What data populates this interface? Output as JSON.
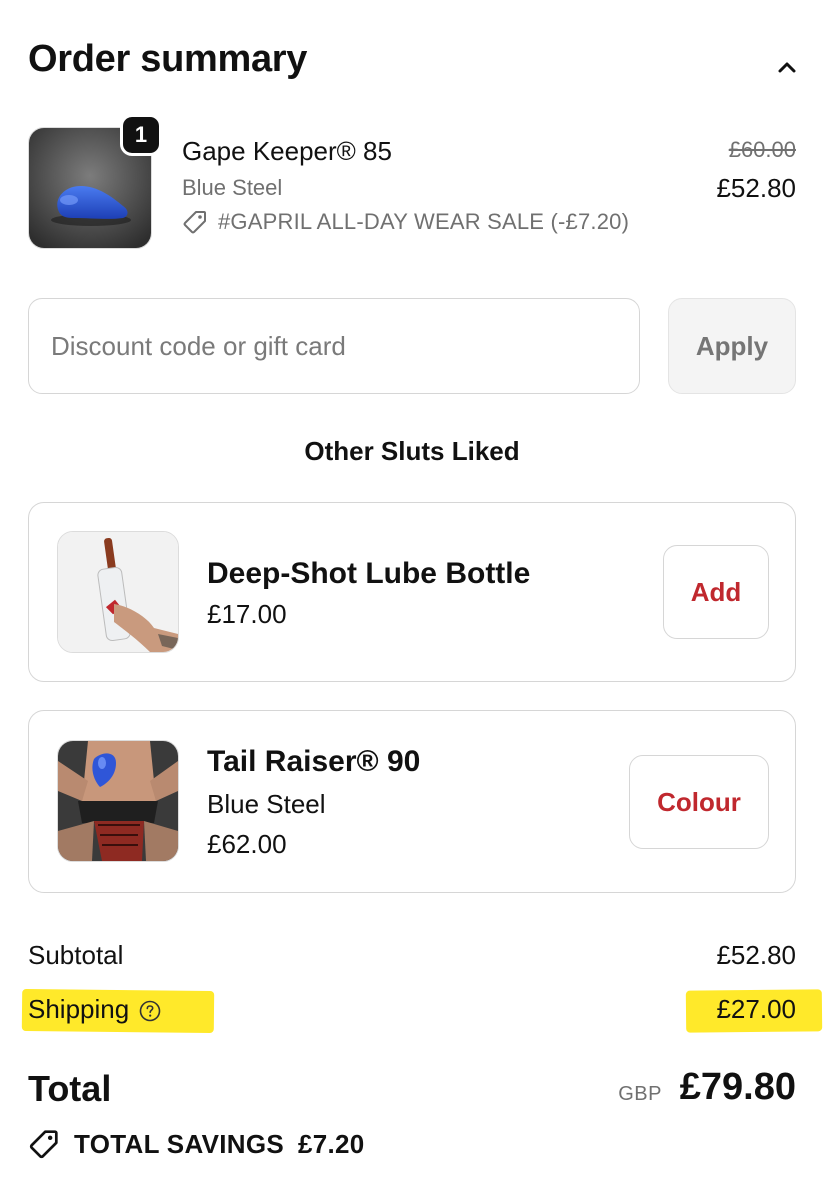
{
  "header": {
    "title": "Order summary",
    "toggle_icon": "chevron-up-icon"
  },
  "order_item": {
    "image": "blue butt plug product photo",
    "quantity": "1",
    "name": "Gape Keeper® 85",
    "variant": "Blue Steel",
    "discount_icon": "tag-icon",
    "discount_label": "#GAPRIL ALL-DAY WEAR SALE (-£7.20)",
    "original_price": "£60.00",
    "price": "£52.80"
  },
  "discount": {
    "placeholder": "Discount code or gift card",
    "value": "",
    "apply_label": "Apply"
  },
  "upsell": {
    "heading": "Other Sluts Liked",
    "items": [
      {
        "title": "Deep-Shot Lube Bottle",
        "variant": "",
        "price": "£17.00",
        "button_label": "Add"
      },
      {
        "title": "Tail Raiser® 90",
        "variant": "Blue Steel",
        "price": "£62.00",
        "button_label": "Colour"
      }
    ]
  },
  "summary": {
    "subtotal_label": "Subtotal",
    "subtotal_value": "£52.80",
    "shipping_label": "Shipping",
    "shipping_value": "£27.00",
    "total_label": "Total",
    "currency": "GBP",
    "total_value": "£79.80",
    "savings_label": "TOTAL SAVINGS",
    "savings_value": "£7.20"
  },
  "colors": {
    "accent_button_text": "#c0282e",
    "highlight": "#ffe92a",
    "muted_text": "#707070"
  }
}
